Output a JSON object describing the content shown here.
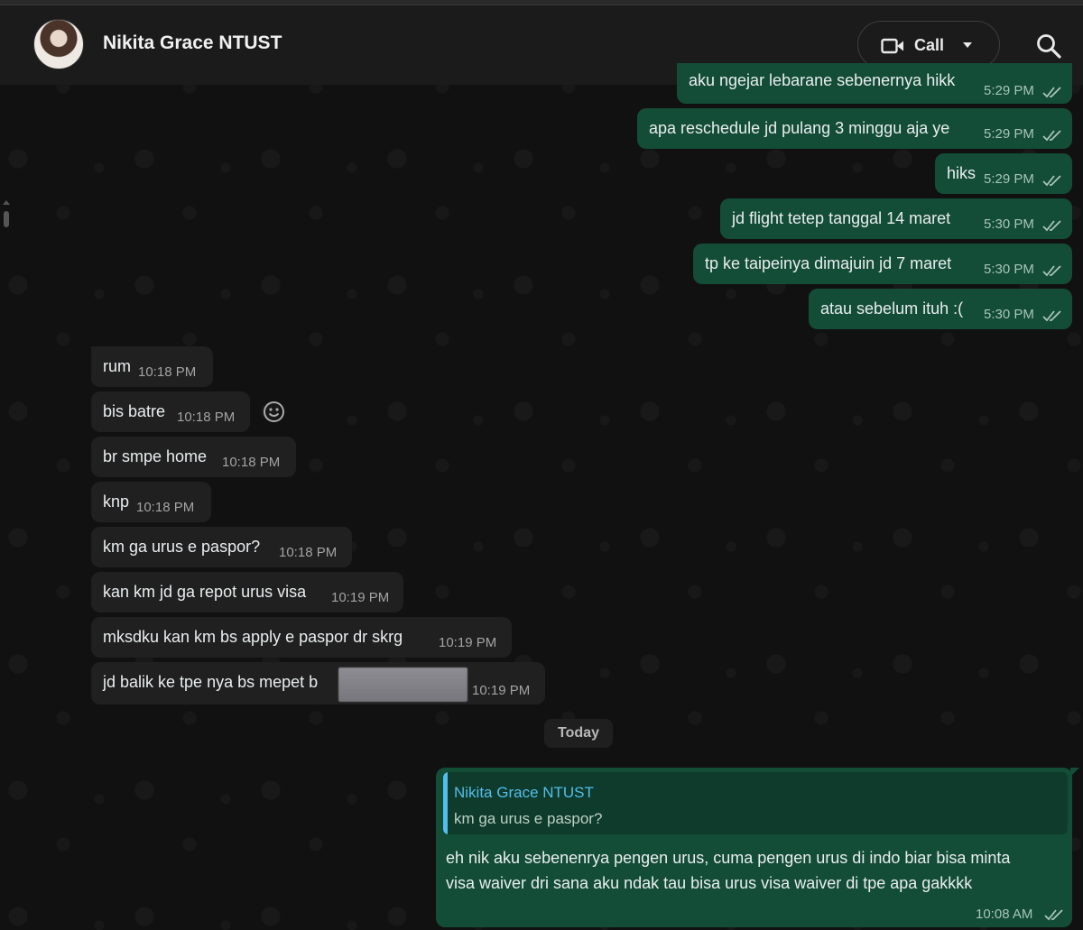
{
  "header": {
    "contact_name": "Nikita Grace NTUST",
    "call_label": "Call"
  },
  "messages_out_top": [
    {
      "text": "aku ngejar lebarane sebenernya hikk",
      "time": "5:29 PM"
    },
    {
      "text": "apa reschedule jd pulang 3 minggu aja ye",
      "time": "5:29 PM"
    },
    {
      "text": "hiks",
      "time": "5:29 PM"
    },
    {
      "text": "jd flight tetep tanggal 14 maret",
      "time": "5:30 PM"
    },
    {
      "text": "tp ke taipeinya dimajuin jd 7 maret",
      "time": "5:30 PM"
    },
    {
      "text": "atau sebelum ituh :(",
      "time": "5:30 PM"
    }
  ],
  "messages_in": [
    {
      "text": "rum",
      "time": "10:18 PM"
    },
    {
      "text": "bis batre",
      "time": "10:18 PM"
    },
    {
      "text": "br smpe home",
      "time": "10:18 PM"
    },
    {
      "text": "knp",
      "time": "10:18 PM"
    },
    {
      "text": "km ga urus e paspor?",
      "time": "10:18 PM"
    },
    {
      "text": "kan km jd ga repot urus visa",
      "time": "10:19 PM"
    },
    {
      "text": "mksdku kan km bs apply e paspor dr skrg",
      "time": "10:19 PM"
    },
    {
      "text": "jd balik ke tpe nya bs mepet b",
      "time": "10:19 PM"
    }
  ],
  "day_separator": "Today",
  "reply_message": {
    "quoted_name": "Nikita Grace NTUST",
    "quoted_text": "km ga urus e paspor?",
    "text": "eh nik aku sebenenrya pengen urus, cuma pengen urus di indo biar bisa minta visa waiver dri sana aku ndak tau bisa urus visa waiver di tpe apa gakkkk",
    "time": "10:08 AM"
  },
  "icons": {
    "call": "video-camera-icon",
    "caret": "chevron-down-icon",
    "search": "search-icon",
    "emoji": "smiley-icon",
    "read": "double-check-icon"
  },
  "colors": {
    "outgoing_bubble": "#134d37",
    "incoming_bubble": "#202020",
    "header": "#1b1b1b",
    "quote_accent": "#53bdeb"
  }
}
